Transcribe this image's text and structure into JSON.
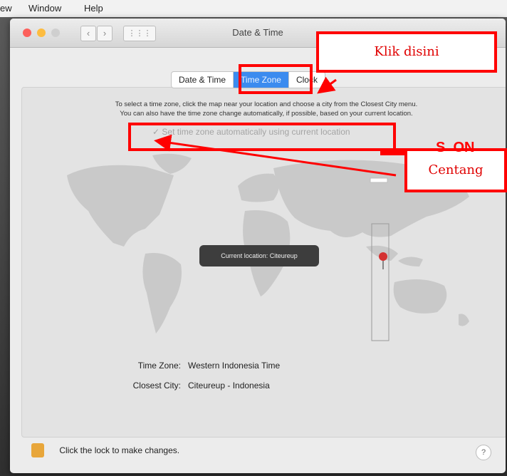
{
  "menubar": {
    "items": [
      "ew",
      "Window",
      "Help"
    ]
  },
  "window": {
    "title": "Date & Time"
  },
  "tabs": [
    {
      "label": "Date & Time",
      "active": false
    },
    {
      "label": "Time Zone",
      "active": true
    },
    {
      "label": "Clock",
      "active": false
    }
  ],
  "instructions": {
    "line1": "To select a time zone, click the map near your location and choose a city from the Closest City menu.",
    "line2": "You can also have the time zone change automatically, if possible, based on your current location."
  },
  "auto_timezone": {
    "label": "Set time zone automatically using current location",
    "checked": true
  },
  "map": {
    "tooltip": "Current location: Citeureup"
  },
  "info": {
    "timezone_label": "Time Zone:",
    "timezone_value": "Western Indonesia Time",
    "city_label": "Closest City:",
    "city_value": "Citeureup - Indonesia"
  },
  "lock": {
    "text": "Click the lock to make changes."
  },
  "help_label": "?",
  "annotations": {
    "klik_disini": "Klik disini",
    "centang": "Centang",
    "partial_overlay": "S  ON"
  },
  "colors": {
    "accent": "#3b8bef",
    "annotation": "#ff0000",
    "close": "#fc605b",
    "minimize": "#fdbc40"
  },
  "icons": [
    "chevron-left-icon",
    "chevron-right-icon",
    "grid-icon",
    "checkmark-icon",
    "map-pin-icon",
    "lock-icon",
    "help-icon"
  ]
}
